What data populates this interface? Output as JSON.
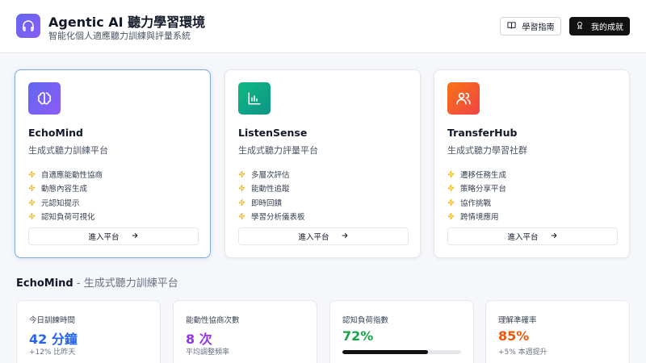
{
  "header": {
    "title": "Agentic AI 聽力學習環境",
    "subtitle": "智能化個人適應聽力訓練與評量系統",
    "logo_icon": "headphones-icon",
    "guide_label": "學習指南",
    "score_label": "我的成就"
  },
  "platforms": [
    {
      "name": "EchoMind",
      "subtitle": "生成式聽力訓練平台",
      "icon": "brain-icon",
      "colors": [
        "#6366f1",
        "#8b5cf6"
      ],
      "features": [
        "自適應能動性協商",
        "動態內容生成",
        "元認知提示",
        "認知負荷可視化"
      ],
      "enter_label": "進入平台",
      "selected": true
    },
    {
      "name": "ListenSense",
      "subtitle": "生成式聽力評量平台",
      "icon": "bar-chart-icon",
      "colors": [
        "#10b981",
        "#0d9488"
      ],
      "features": [
        "多層次評估",
        "能動性追蹤",
        "即時回饋",
        "學習分析儀表板"
      ],
      "enter_label": "進入平台",
      "selected": false
    },
    {
      "name": "TransferHub",
      "subtitle": "生成式聽力學習社群",
      "icon": "users-icon",
      "colors": [
        "#f97316",
        "#ef4444"
      ],
      "features": [
        "遷移任務生成",
        "策略分享平台",
        "協作挑戰",
        "跨情境應用"
      ],
      "enter_label": "進入平台",
      "selected": false
    }
  ],
  "section": {
    "name": "EchoMind",
    "subtitle": " - 生成式聽力訓練平台"
  },
  "stats": [
    {
      "label": "今日訓練時間",
      "value": "42 分鐘",
      "note": "+12% 比昨天",
      "color": "#2563eb"
    },
    {
      "label": "能動性協商次數",
      "value": "8 次",
      "note": "平均調整頻率",
      "color": "#9333ea"
    },
    {
      "label": "認知負荷指數",
      "value": "72%",
      "progress": 0.72,
      "color": "#16a34a"
    },
    {
      "label": "理解準確率",
      "value": "85%",
      "note": "+5% 本週提升",
      "color": "#ea580c"
    }
  ]
}
